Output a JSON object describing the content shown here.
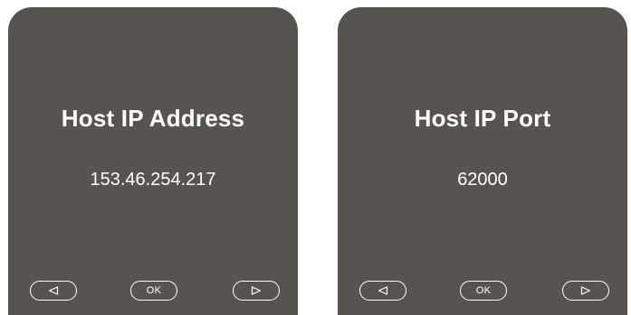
{
  "colors": {
    "screen_bg": "#57534f",
    "text": "#ffffff",
    "page_bg": "#ffffff"
  },
  "screens": [
    {
      "title": "Host IP Address",
      "value": "153.46.254.217",
      "softkeys": {
        "left_icon": "triangle-left-icon",
        "ok_label": "OK",
        "right_icon": "triangle-right-icon"
      }
    },
    {
      "title": "Host IP Port",
      "value": "62000",
      "softkeys": {
        "left_icon": "triangle-left-icon",
        "ok_label": "OK",
        "right_icon": "triangle-right-icon"
      }
    }
  ]
}
